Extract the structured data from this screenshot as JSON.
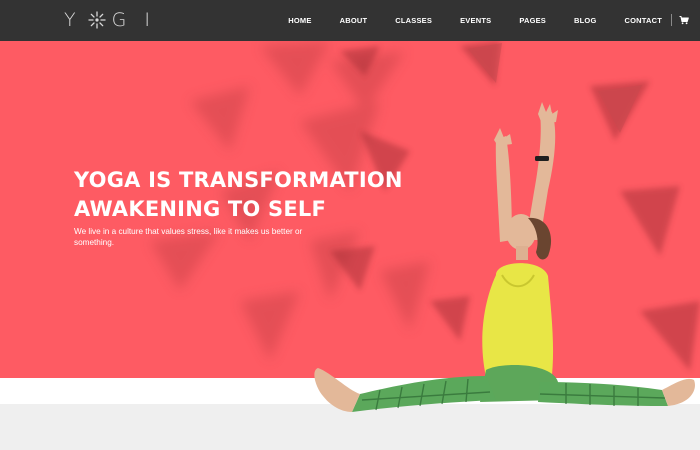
{
  "brand": {
    "logo_left": "Y",
    "logo_right": "G I"
  },
  "nav": {
    "items": [
      "HOME",
      "ABOUT",
      "CLASSES",
      "EVENTS",
      "PAGES",
      "BLOG",
      "CONTACT"
    ]
  },
  "hero": {
    "headline_line1": "YOGA IS TRANSFORMATION",
    "headline_line2": "AWAKENING TO SELF",
    "subtext": "We live in a culture that values stress, like it makes us better or something."
  },
  "colors": {
    "hero_bg": "#fe5b63",
    "nav_bg": "#333333",
    "floor": "#efefef"
  },
  "icons": {
    "logo_mark": "lotus-icon",
    "cart": "cart-icon"
  }
}
